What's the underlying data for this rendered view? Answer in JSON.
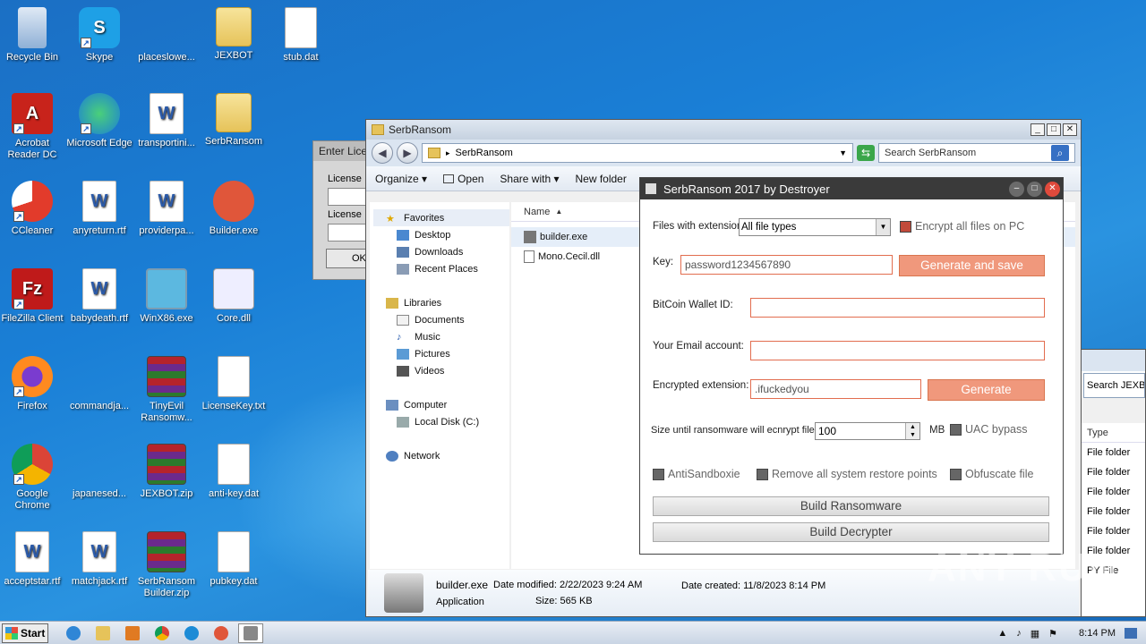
{
  "desktop": {
    "icons": [
      {
        "label": "Recycle Bin",
        "icon": "recycle-bin-icon"
      },
      {
        "label": "Skype",
        "icon": "skype-icon"
      },
      {
        "label": "placeslowe...",
        "icon": "blank-file-icon"
      },
      {
        "label": "JEXBOT",
        "icon": "folder-icon"
      },
      {
        "label": "stub.dat",
        "icon": "file-icon"
      },
      {
        "label": "Acrobat Reader DC",
        "icon": "acrobat-icon"
      },
      {
        "label": "Microsoft Edge",
        "icon": "edge-icon"
      },
      {
        "label": "transportini...",
        "icon": "word-doc-icon"
      },
      {
        "label": "SerbRansom",
        "icon": "folder-icon"
      },
      {
        "label": "CCleaner",
        "icon": "ccleaner-icon"
      },
      {
        "label": "anyreturn.rtf",
        "icon": "word-doc-icon"
      },
      {
        "label": "providerpa...",
        "icon": "word-doc-icon"
      },
      {
        "label": "Builder.exe",
        "icon": "builder-icon"
      },
      {
        "label": "FileZilla Client",
        "icon": "filezilla-icon"
      },
      {
        "label": "babydeath.rtf",
        "icon": "word-doc-icon"
      },
      {
        "label": "WinX86.exe",
        "icon": "exe-icon"
      },
      {
        "label": "Core.dll",
        "icon": "dll-icon"
      },
      {
        "label": "Firefox",
        "icon": "firefox-icon"
      },
      {
        "label": "commandja...",
        "icon": "blank-file-icon"
      },
      {
        "label": "TinyEvil Ransomw...",
        "icon": "winrar-icon"
      },
      {
        "label": "LicenseKey.txt",
        "icon": "text-file-icon"
      },
      {
        "label": "Google Chrome",
        "icon": "chrome-icon"
      },
      {
        "label": "japanesed...",
        "icon": "blank-file-icon"
      },
      {
        "label": "JEXBOT.zip",
        "icon": "winrar-icon"
      },
      {
        "label": "anti-key.dat",
        "icon": "file-icon"
      },
      {
        "label": "acceptstar.rtf",
        "icon": "word-doc-icon"
      },
      {
        "label": "matchjack.rtf",
        "icon": "word-doc-icon"
      },
      {
        "label": "SerbRansom Builder.zip",
        "icon": "winrar-icon"
      },
      {
        "label": "pubkey.dat",
        "icon": "file-icon"
      }
    ]
  },
  "license_window": {
    "title": "Enter Lice",
    "label1": "License",
    "label2": "License",
    "ok": "OK"
  },
  "explorer": {
    "title": "SerbRansom",
    "breadcrumb": "SerbRansom",
    "search_placeholder": "Search SerbRansom",
    "toolbar": {
      "organize": "Organize",
      "open": "Open",
      "share": "Share with",
      "new_folder": "New folder"
    },
    "nav": {
      "favorites": "Favorites",
      "desktop": "Desktop",
      "downloads": "Downloads",
      "recent": "Recent Places",
      "libraries": "Libraries",
      "documents": "Documents",
      "music": "Music",
      "pictures": "Pictures",
      "videos": "Videos",
      "computer": "Computer",
      "local_disk": "Local Disk (C:)",
      "network": "Network"
    },
    "column_name": "Name",
    "files": [
      "builder.exe",
      "Mono.Cecil.dll"
    ],
    "details": {
      "name": "builder.exe",
      "type": "Application",
      "modified_label": "Date modified:",
      "modified": "2/22/2023 9:24 AM",
      "size_label": "Size:",
      "size": "565 KB",
      "created_label": "Date created:",
      "created": "11/8/2023 8:14 PM"
    }
  },
  "builder": {
    "title": "SerbRansom 2017 by Destroyer",
    "ext_label": "Files with extension",
    "ext_value": "All file types",
    "encrypt_all": "Encrypt all files on PC",
    "key_label": "Key:",
    "key_value": "password1234567890",
    "generate_save": "Generate and save",
    "wallet_label": "BitCoin Wallet ID:",
    "email_label": "Your Email account:",
    "enc_ext_label": "Encrypted extension:",
    "enc_ext_value": ".ifuckedyou",
    "generate": "Generate",
    "size_label": "Size until ransomware will ecnrypt file",
    "size_value": "100",
    "size_unit": "MB",
    "uac": "UAC bypass",
    "antisandbox": "AntiSandboxie",
    "restore_points": "Remove all system restore points",
    "obfuscate": "Obfuscate file",
    "build_ransomware": "Build Ransomware",
    "build_decrypter": "Build Decrypter"
  },
  "right_window": {
    "search": "Search JEXBOT",
    "type_header": "Type",
    "types": [
      "File folder",
      "File folder",
      "File folder",
      "File folder",
      "File folder",
      "File folder",
      "PY File"
    ]
  },
  "taskbar": {
    "start": "Start",
    "time": "8:14 PM"
  },
  "watermark": "ANY RUN",
  "colors": {
    "accent_orange": "#f0987c",
    "builder_title": "#3a3a3a",
    "desktop_blue": "#1a7fd6"
  }
}
